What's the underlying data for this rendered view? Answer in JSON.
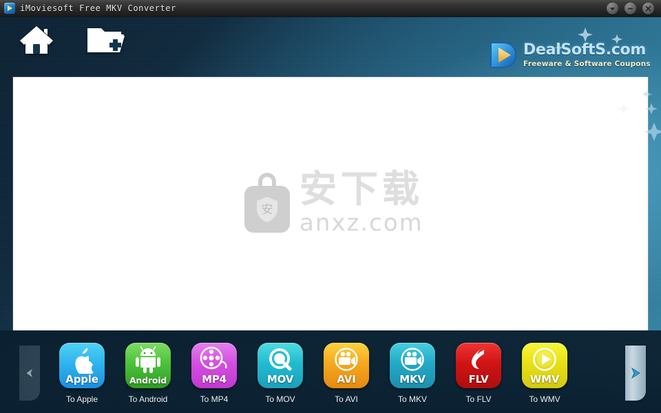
{
  "window": {
    "title": "iMoviesoft Free MKV Converter",
    "app_icon": "app-play-icon",
    "buttons": [
      {
        "name": "collapse-button",
        "icon": "chevron-down-icon",
        "label": "Collapse"
      },
      {
        "name": "minimize-button",
        "icon": "minimize-icon",
        "label": "Minimize"
      },
      {
        "name": "close-button",
        "icon": "close-icon",
        "label": "Close"
      }
    ]
  },
  "toolbar": {
    "items": [
      {
        "name": "home-button",
        "icon": "home-icon",
        "label": "Home"
      },
      {
        "name": "add-folder-button",
        "icon": "add-folder-icon",
        "label": "Add Folder"
      }
    ]
  },
  "brand": {
    "title": "DealSoftS.com",
    "subtitle": "Freeware & Software Coupons",
    "mark": "dealsofts-play-logo",
    "title_color": "#bfe4f7",
    "subtitle_color": "#f3ecc7"
  },
  "main_panel": {
    "background_color": "#ffffff",
    "watermark": {
      "icon": "anxz-bag-icon",
      "chinese_text": "安下载",
      "text": "anxz.com",
      "color": "#d8d8d8"
    }
  },
  "dock": {
    "scroll_left": {
      "name": "scroll-left-button",
      "icon": "triangle-left-icon",
      "enabled": false
    },
    "scroll_right": {
      "name": "scroll-right-button",
      "icon": "triangle-right-icon",
      "enabled": true
    },
    "targets": [
      {
        "id": "apple",
        "cap": "Apple",
        "label": "To Apple",
        "glyph": "apple-logo-icon",
        "color": "#2fb4ee"
      },
      {
        "id": "android",
        "cap": "Android",
        "label": "To Android",
        "glyph": "android-robot-icon",
        "color": "#4cc23c"
      },
      {
        "id": "mp4",
        "cap": "MP4",
        "label": "To MP4",
        "glyph": "film-reel-icon",
        "color": "#d34fe0"
      },
      {
        "id": "mov",
        "cap": "MOV",
        "label": "To MOV",
        "glyph": "quicktime-q-icon",
        "color": "#21bcd0"
      },
      {
        "id": "avi",
        "cap": "AVI",
        "label": "To AVI",
        "glyph": "camcorder-icon",
        "color": "#f5a81e"
      },
      {
        "id": "mkv",
        "cap": "MKV",
        "label": "To MKV",
        "glyph": "camcorder-icon",
        "color": "#24a9c6"
      },
      {
        "id": "flv",
        "cap": "FLV",
        "label": "To FLV",
        "glyph": "flash-f-icon",
        "color": "#d01414"
      },
      {
        "id": "wmv",
        "cap": "WMV",
        "label": "To WMV",
        "glyph": "play-circle-icon",
        "color": "#e8e016"
      }
    ]
  }
}
